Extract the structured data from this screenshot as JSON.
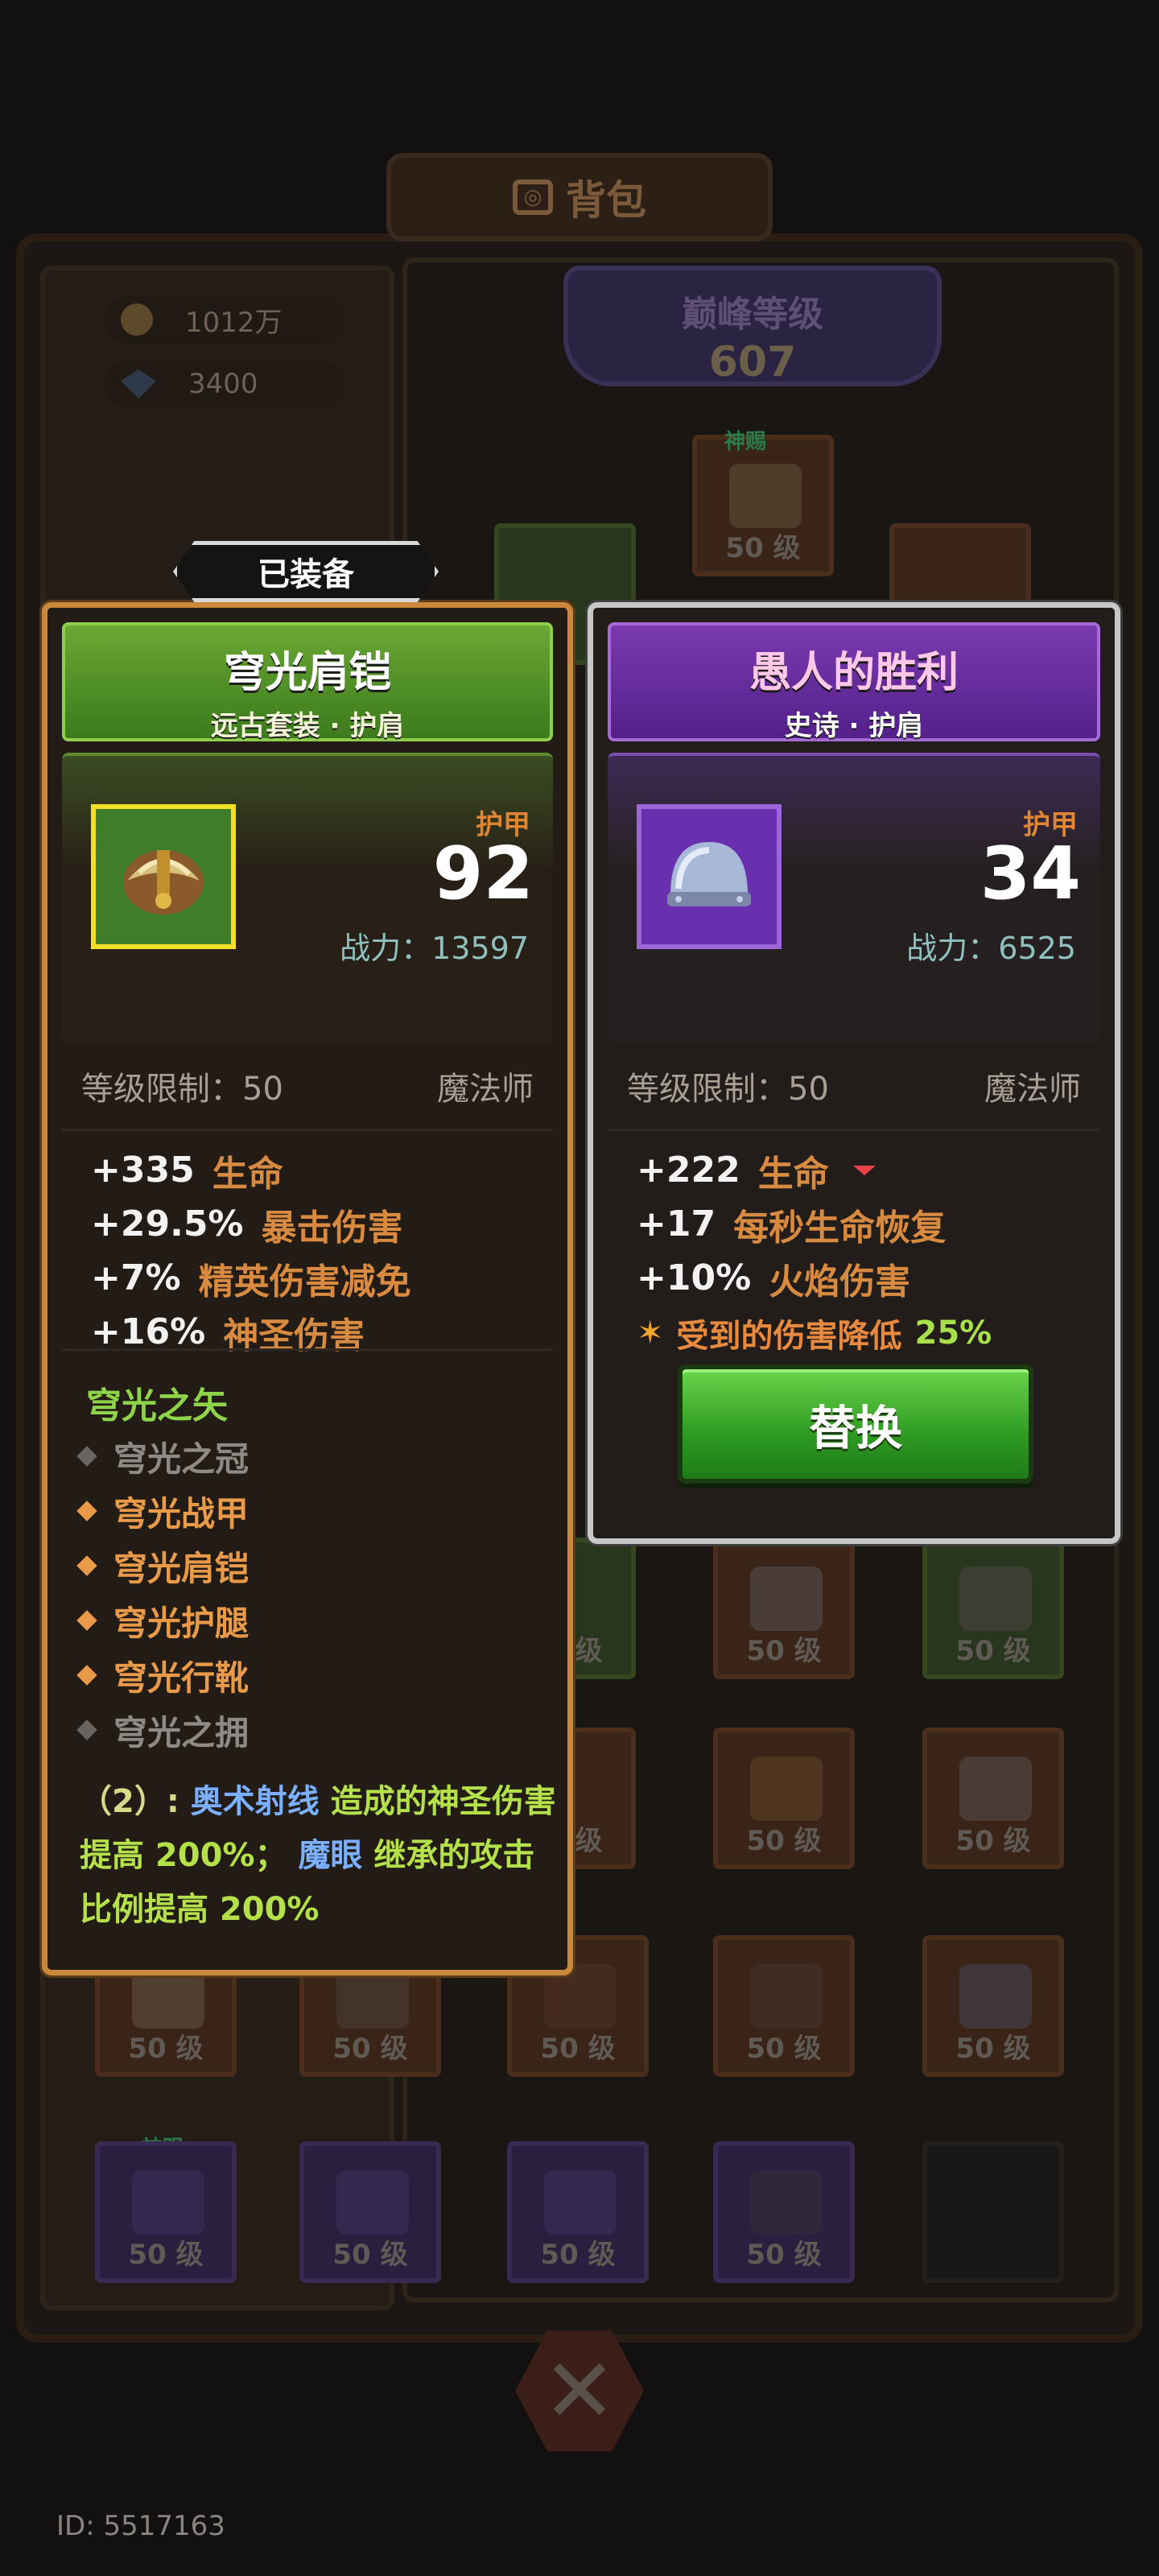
{
  "header": {
    "title": "背包"
  },
  "currency": {
    "gold": "1012万",
    "gems": "3400"
  },
  "peak": {
    "title": "巅峰等级",
    "value": "607"
  },
  "background_slots": {
    "level_label": "50 级",
    "divine_label": "神赐"
  },
  "equipped_tag": "已装备",
  "equipped": {
    "name": "穹光肩铠",
    "subtitle": "远古套装 · 护肩",
    "stat_label": "护甲",
    "stat_value": "92",
    "power": "战力：13597",
    "level_req": "等级限制：50",
    "class": "魔法师",
    "stats": [
      {
        "num": "+335",
        "name": "生命"
      },
      {
        "num": "+29.5%",
        "name": "暴击伤害"
      },
      {
        "num": "+7%",
        "name": "精英伤害减免"
      },
      {
        "num": "+16%",
        "name": "神圣伤害"
      }
    ],
    "set_name": "穹光之矢",
    "set_items": [
      {
        "label": "穹光之冠",
        "owned": false
      },
      {
        "label": "穹光战甲",
        "owned": true
      },
      {
        "label": "穹光肩铠",
        "owned": true
      },
      {
        "label": "穹光护腿",
        "owned": true
      },
      {
        "label": "穹光行靴",
        "owned": true
      },
      {
        "label": "穹光之拥",
        "owned": false
      }
    ],
    "set_bonus": {
      "tier": "（2）:",
      "skill1": "奥术射线",
      "desc1": "造成的神圣伤害提高 200%；",
      "skill2": "魔眼",
      "desc2": "继承的攻击比例提高 200%"
    }
  },
  "candidate": {
    "name": "愚人的胜利",
    "subtitle": "史诗 · 护肩",
    "stat_label": "护甲",
    "stat_value": "34",
    "power": "战力：6525",
    "level_req": "等级限制：50",
    "class": "魔法师",
    "stats": [
      {
        "num": "+222",
        "name": "生命"
      },
      {
        "num": "+17",
        "name": "每秒生命恢复"
      },
      {
        "num": "+10%",
        "name": "火焰伤害"
      }
    ],
    "special": {
      "text": "受到的伤害降低",
      "value": "25%"
    },
    "replace_label": "替换"
  },
  "footer": {
    "id_text": "ID: 5517163"
  }
}
